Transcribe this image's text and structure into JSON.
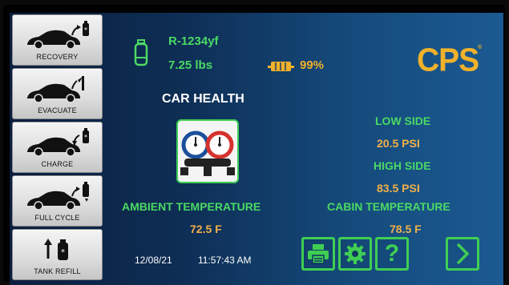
{
  "sidebar": {
    "items": [
      {
        "label": "RECOVERY",
        "icon": "car-recovery-icon"
      },
      {
        "label": "EVACUATE",
        "icon": "car-evacuate-icon"
      },
      {
        "label": "CHARGE",
        "icon": "car-charge-icon"
      },
      {
        "label": "FULL CYCLE",
        "icon": "car-full-cycle-icon"
      },
      {
        "label": "TANK REFILL",
        "icon": "tank-refill-icon"
      }
    ]
  },
  "tank": {
    "refrigerant": "R-1234yf",
    "weight": "7.25 lbs",
    "battery_percent": "99%",
    "icon": "tank-icon"
  },
  "brand": {
    "logo": "CPS"
  },
  "car_health": {
    "title": "CAR HEALTH",
    "icon": "manifold-gauge-icon"
  },
  "readings": {
    "low_side_label": "LOW SIDE",
    "low_side_value": "20.5 PSI",
    "high_side_label": "HIGH SIDE",
    "high_side_value": "83.5 PSI",
    "ambient_label": "AMBIENT TEMPERATURE",
    "ambient_value": "72.5 F",
    "cabin_label": "CABIN TEMPERATURE",
    "cabin_value": "78.5 F"
  },
  "status": {
    "date": "12/08/21",
    "time": "11:57:43 AM"
  },
  "controls": {
    "print_icon": "print-icon",
    "settings_icon": "gear-icon",
    "help_icon": "help-icon",
    "help_glyph": "?",
    "next_icon": "chevron-right-icon"
  },
  "colors": {
    "accent_green": "#4bd964",
    "value_orange": "#f2b04a",
    "logo_gold": "#f0b12b"
  }
}
